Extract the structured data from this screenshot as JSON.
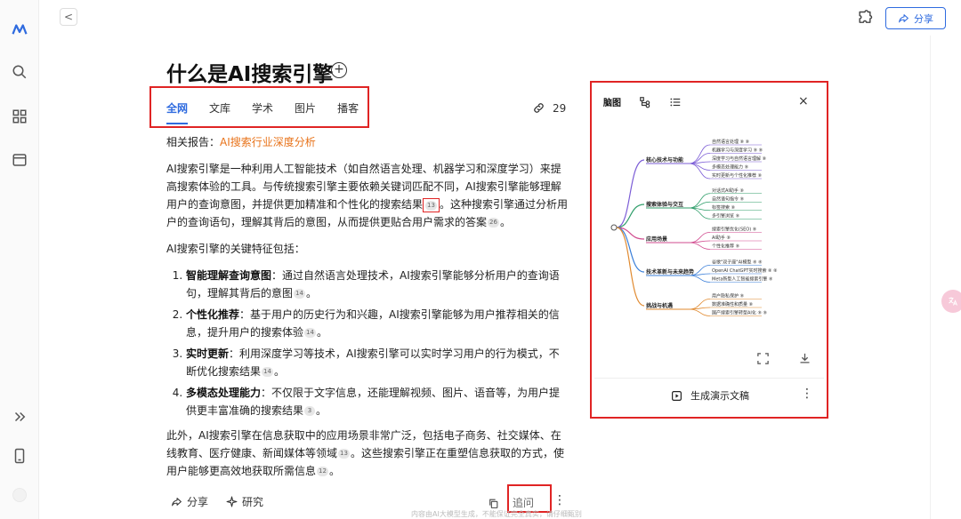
{
  "header": {
    "back_glyph": "<",
    "share_label": "分享"
  },
  "title": "什么是AI搜索引擎",
  "tabs": [
    {
      "label": "全网",
      "active": true
    },
    {
      "label": "文库",
      "active": false
    },
    {
      "label": "学术",
      "active": false
    },
    {
      "label": "图片",
      "active": false
    },
    {
      "label": "播客",
      "active": false
    }
  ],
  "link_count": "29",
  "article": {
    "report_label": "相关报告：",
    "report_link": "AI搜索行业深度分析",
    "intro_a": "AI搜索引擎是一种利用人工智能技术（如自然语言处理、机器学习和深度学习）来提高搜索体验的工具。与传统搜索引擎主要依赖关键词匹配不同，AI搜索引擎能够理解用户的查询意图，并提供更加精准和个性化的搜索结果",
    "intro_cite1": "13",
    "intro_b": "。这种搜索引擎通过分析用户的查询语句，理解其背后的意图，从而提供更贴合用户需求的答案",
    "intro_cite2": "26",
    "intro_c": "。",
    "features_lead": "AI搜索引擎的关键特征包括：",
    "features": [
      {
        "title": "智能理解查询意图",
        "text": "：通过自然语言处理技术，AI搜索引擎能够分析用户的查询语句，理解其背后的意图",
        "cite": "14",
        "end": "。"
      },
      {
        "title": "个性化推荐",
        "text": "：基于用户的历史行为和兴趣，AI搜索引擎能够为用户推荐相关的信息，提升用户的搜索体验",
        "cite": "14",
        "end": "。"
      },
      {
        "title": "实时更新",
        "text": "：利用深度学习等技术，AI搜索引擎可以实时学习用户的行为模式，不断优化搜索结果",
        "cite": "14",
        "end": "。"
      },
      {
        "title": "多模态处理能力",
        "text": "：不仅限于文字信息，还能理解视频、图片、语音等，为用户提供更丰富准确的搜索结果",
        "cite": "3",
        "end": "。"
      }
    ],
    "outro_a": "此外，AI搜索引擎在信息获取中的应用场景非常广泛，包括电子商务、社交媒体、在线教育、医疗健康、新闻媒体等领域",
    "outro_cite1": "13",
    "outro_b": "。这些搜索引擎正在重塑信息获取的方式，使用户能够更高效地获取所需信息",
    "outro_cite2": "12",
    "outro_c": "。"
  },
  "bottom": {
    "share_label": "分享",
    "research_label": "研究",
    "ask_label": "追问",
    "more_glyph": "⋮",
    "disclaimer": "内容由AI大模型生成，不能保证完全真实，请仔细甄别"
  },
  "panel": {
    "tab_mindmap": "脑图",
    "close_glyph": "×",
    "generate_label": "生成演示文稿",
    "more_glyph": "⋮",
    "mindmap": {
      "branches": [
        {
          "label": "核心技术与功能",
          "color": "#7b5cd6",
          "leaves": [
            "自然语言处理 ⑧ ⑧",
            "机器学习与深度学习 ⑧ ⑧",
            "深度学习与自然语言理解 ⑧",
            "多模态处理能力 ⑧",
            "实时更新与个性化推荐 ⑧"
          ]
        },
        {
          "label": "搜索体验与交互",
          "color": "#2f9e6a",
          "leaves": [
            "对话式AI助手 ⑧",
            "自然语句指令 ⑧",
            "标签搜索 ⑧",
            "多引擎浏览 ⑧"
          ]
        },
        {
          "label": "应用场景",
          "color": "#d14b8f",
          "leaves": [
            "搜索引擎优化(SEO) ⑧",
            "AI助手 ⑧",
            "个性化推荐 ⑧"
          ]
        },
        {
          "label": "技术革新与未来趋势",
          "color": "#3b7fd9",
          "leaves": [
            "谷歌\"双子座\"AI模型 ⑧ ⑧",
            "OpenAI ChatGPT实时搜索 ⑧ ⑧",
            "Meta新型人工智能搜索引擎 ⑧"
          ]
        },
        {
          "label": "挑战与机遇",
          "color": "#e0892e",
          "leaves": [
            "用户隐私保护 ⑧",
            "数据准确性和质量 ⑧",
            "国产搜索引擎转型AI化 ⑧ ⑧"
          ]
        }
      ]
    }
  },
  "colors": {
    "accent": "#2f6bdf",
    "report_link": "#e8731a",
    "highlight_box": "#e02424"
  }
}
